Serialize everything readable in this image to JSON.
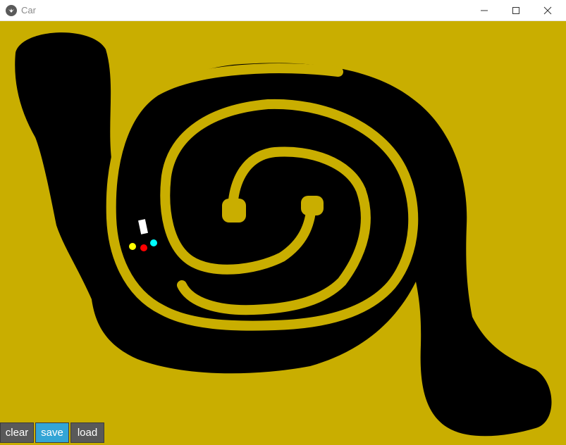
{
  "window": {
    "title": "Car",
    "controls": [
      "minimize",
      "maximize",
      "close"
    ]
  },
  "colors": {
    "sand": "#c9ae00",
    "road": "#000000",
    "car": "#ffffff",
    "sensor_left": "#ffff00",
    "sensor_center": "#ff0000",
    "sensor_right": "#00ffff",
    "save_button": "#33a5d6",
    "button": "#595959"
  },
  "toolbar": {
    "clear_label": "clear",
    "save_label": "save",
    "load_label": "load"
  }
}
